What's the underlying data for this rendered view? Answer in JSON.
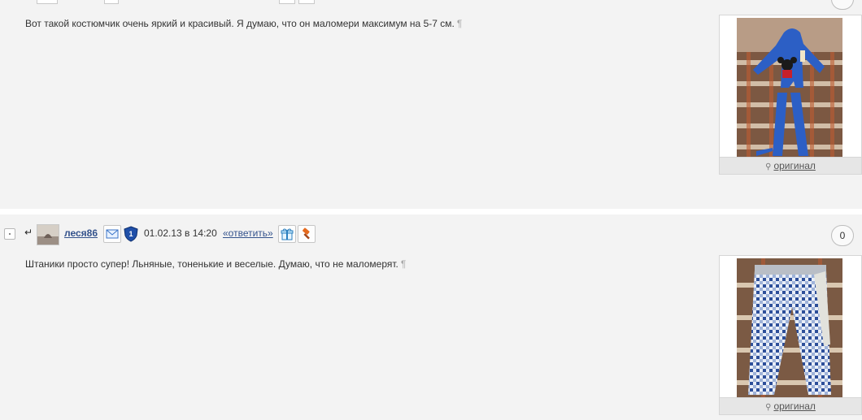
{
  "post1": {
    "text": "Вот такой костюмчик очень яркий и красивый. Я думаю, что он маломери максимум на 5-7 см.",
    "pilcrow": "¶",
    "image_link": "оригинал"
  },
  "post2": {
    "username": "леся86",
    "datetime": "01.02.13 в 14:20",
    "reply_label": "«ответить»",
    "rank_badge": "1",
    "counter": "0",
    "text": "Штаники просто супер! Льняные, тоненькие и веселые. Думаю, что не маломерят.",
    "pilcrow": "¶",
    "image_link": "оригинал"
  },
  "icons": {
    "reply_arrow": "↵",
    "zoom": "🔍"
  },
  "colors": {
    "background": "#f3f3f3",
    "link": "#33528c",
    "separator": "#ffffff"
  }
}
